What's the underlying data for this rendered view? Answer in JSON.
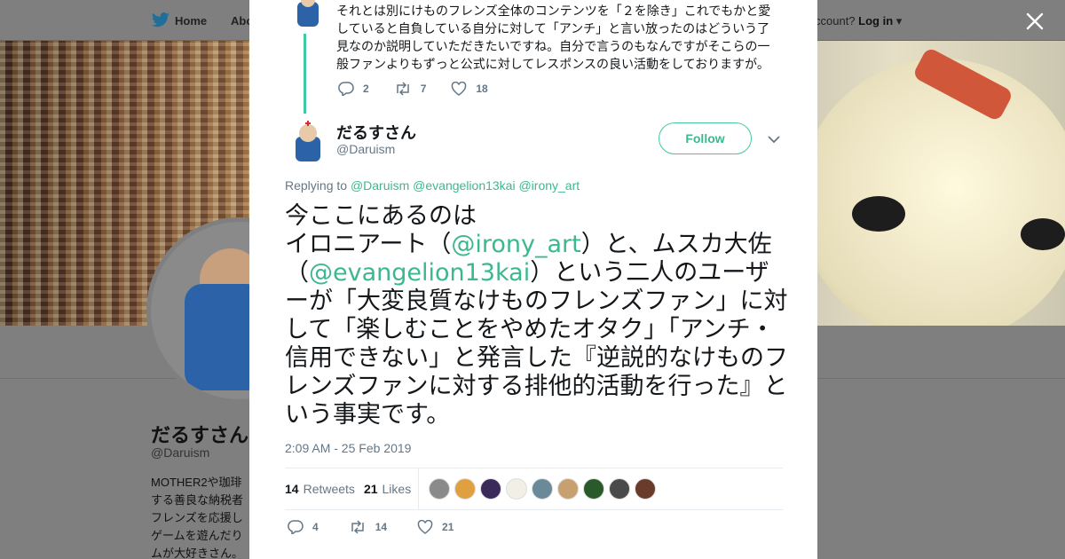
{
  "nav": {
    "home": "Home",
    "about": "Abo",
    "account_prompt": "ccount?",
    "login": "Log in"
  },
  "profile": {
    "name": "だるすさん",
    "handle": "@Daruism",
    "bio": "MOTHER2や珈琲\nする善良な納税者\nフレンズを応援し\nゲームを遊んだり\nムが大好きさん。"
  },
  "previous_tweet": {
    "text": "それとは別にけものフレンズ全体のコンテンツを「２を除き」これでもかと愛\nしていると自負している自分に対して「アンチ」と言い放ったのはどういう了\n見なのか説明していただきたいですね。自分で言うのもなんですがそこらの一\n般ファンよりもずっと公式に対してレスポンスの良い活動をしておりますが。",
    "replies": "2",
    "retweets": "7",
    "likes": "18"
  },
  "tweet": {
    "author_name": "だるすさん",
    "author_handle": "@Daruism",
    "follow_label": "Follow",
    "replying_prefix": "Replying to",
    "replying_mentions": [
      "@Daruism",
      "@evangelion13kai",
      "@irony_art"
    ],
    "text_parts": {
      "p1": "今ここにあるのは",
      "p2": "イロニアート（",
      "m1": "@irony_art",
      "p3": "）と、ムスカ大佐（",
      "m2": "@evangelion13kai",
      "p4": "）という二人のユーザーが「大変良質なけものフレンズファン」に対して「楽しむことをやめたオタク」「アンチ・信用できない」と発言した『逆説的なけものフレンズファンに対する排他的活動を行った』という事実です。"
    },
    "timestamp": "2:09 AM - 25 Feb 2019",
    "retweets_count": "14",
    "retweets_label": "Retweets",
    "likes_count": "21",
    "likes_label": "Likes",
    "action_replies": "4",
    "action_retweets": "14",
    "action_likes": "21",
    "liker_colors": [
      "#8a8a8a",
      "#e0a040",
      "#3a2a5a",
      "#f2efe6",
      "#6a8a9a",
      "#c8a070",
      "#2a5a2a",
      "#4a4a4a",
      "#6a3a2a"
    ]
  },
  "colors": {
    "accent": "#3cb890",
    "thread_line": "#41c9a1",
    "muted": "#657786",
    "overlay": "#7f7f7f"
  }
}
